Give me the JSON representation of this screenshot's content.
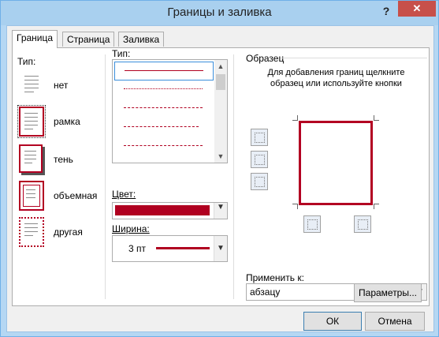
{
  "window": {
    "title": "Границы и заливка",
    "help_label": "?",
    "close_label": "✕"
  },
  "tabs": [
    {
      "label": "Граница",
      "active": true
    },
    {
      "label": "Страница",
      "active": false
    },
    {
      "label": "Заливка",
      "active": false
    }
  ],
  "type_section": {
    "label": "Тип:",
    "items": [
      {
        "label": "нет",
        "icon": "none-border-icon"
      },
      {
        "label": "рамка",
        "icon": "box-border-icon",
        "selected": true
      },
      {
        "label": "тень",
        "icon": "shadow-border-icon"
      },
      {
        "label": "объемная",
        "icon": "3d-border-icon"
      },
      {
        "label": "другая",
        "icon": "custom-border-icon"
      }
    ]
  },
  "style_section": {
    "type_label": "Тип:",
    "line_styles": [
      "solid",
      "dotted",
      "dash-dot-dot",
      "dashed",
      "dash-dot"
    ],
    "color_label": "Цвет:",
    "color_value": "#b00020",
    "width_label": "Ширина:",
    "width_value": "3 пт"
  },
  "preview_section": {
    "label": "Образец",
    "hint": "Для добавления границ щелкните образец или используйте кнопки",
    "apply_label": "Применить к:",
    "apply_value": "абзацу",
    "params_button": "Параметры..."
  },
  "footer": {
    "ok": "ОК",
    "cancel": "Отмена"
  },
  "colors": {
    "accent_border": "#b30022",
    "titlebar": "#a9d0ef",
    "close": "#c7504a"
  }
}
